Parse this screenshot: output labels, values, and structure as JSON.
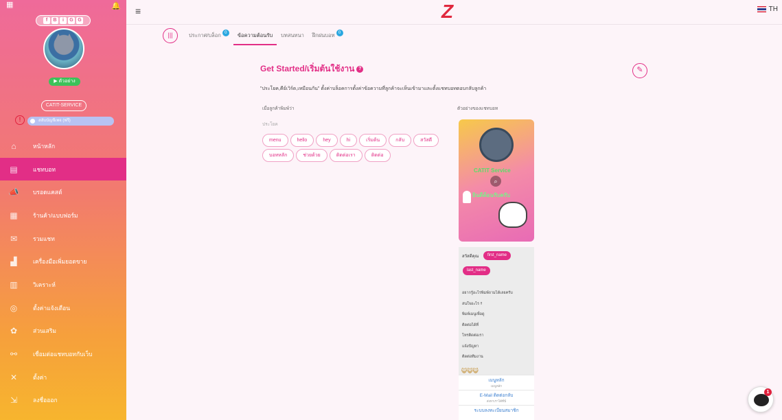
{
  "header": {
    "logo": "Z",
    "lang_code": "TH"
  },
  "profile": {
    "badges": [
      "f",
      "B",
      "i",
      "G",
      "G"
    ],
    "status_label": "▶ ตัวอย่าง",
    "name": "CATIT-SERVICE",
    "switch_label": "สลับบัญชีเพจ (ฟรี)"
  },
  "sidebar": {
    "items": [
      {
        "label": "หน้าหลัก",
        "icon": "home-icon"
      },
      {
        "label": "แชทบอท",
        "icon": "chat-icon"
      },
      {
        "label": "บรอดแคสต์",
        "icon": "broadcast-icon"
      },
      {
        "label": "ร้านค้า/แบบฟอร์ม",
        "icon": "shop-icon"
      },
      {
        "label": "รวมแชท",
        "icon": "inbox-icon"
      },
      {
        "label": "เครื่องมือเพิ่มยอดขาย",
        "icon": "tools-icon"
      },
      {
        "label": "วิเคราะห์",
        "icon": "analytics-icon"
      },
      {
        "label": "ตั้งค่าแจ้งเตือน",
        "icon": "bell-icon"
      },
      {
        "label": "ส่วนเสริม",
        "icon": "addon-icon"
      },
      {
        "label": "เชื่อมต่อแชทบอทกับเว็บ",
        "icon": "link-icon"
      },
      {
        "label": "ตั้งค่า",
        "icon": "settings-icon"
      },
      {
        "label": "ลงชื่อออก",
        "icon": "logout-icon"
      }
    ]
  },
  "tabs": {
    "items": [
      {
        "label": "ประกาศ/บล็อก",
        "badge": "0"
      },
      {
        "label": "ข้อความต้อนรับ",
        "badge": ""
      },
      {
        "label": "บทสนทนา",
        "badge": ""
      },
      {
        "label": "ฝึกฝนบอท",
        "badge": "0"
      }
    ]
  },
  "main": {
    "title": "Get Started/เริ่มต้นใช้งาน",
    "description": "\"ประโยค,คีย์เวิร์ด,เหมือนกัน\" ตั้งค่าบล็อคการตั้งค่าข้อความที่ลูกค้าจะเห็นเข้ามาและตั้งแชทบอทตอบกลับลูกค้า",
    "left_label": "เมื่อลูกค้าพิมพ์ว่า",
    "right_label": "ตัวอย่างของแชทบอท",
    "keywords_label": "ประโยค",
    "keywords": [
      "menu",
      "hello",
      "hey",
      "hi",
      "เริ่มต้น",
      "กลับ",
      "สวัสดี",
      "บอทหลัก",
      "ช่วยด้วย",
      "ติดต่อเรา",
      "ติดต่อ"
    ]
  },
  "preview": {
    "image_text_1": "CATIT Service",
    "image_text_2": "ยินดีต้อนรับครับ",
    "greeting": "สวัสดีคุณ",
    "var_first": "first_name",
    "var_last": "last_name",
    "message": "อยากรู้อะไรพิมพ์ถามได้เลยครับ\nสนใจอะไร !!\nพิมพ์เมนูเพื่อดู\nติดต่อได้ที่\nโทรติดต่อเรา\nแจ้งปัญหา\nติดต่อทีมงาน",
    "emojis": "😺😺😺",
    "buttons": [
      {
        "label": "เมนูหลัก",
        "sub": "เมนูหลัก"
      },
      {
        "label": "E-Mail ติดต่อกลับ",
        "sub": "ส่งหาเราได้ที่นี่"
      },
      {
        "label": "ระบบลงทะเบียนสมาชิก",
        "sub": ""
      }
    ]
  },
  "fab": {
    "notification_count": "1"
  },
  "colors": {
    "accent": "#e22e86",
    "logo": "#e0283e",
    "tab_badge": "#2aa7e0"
  }
}
